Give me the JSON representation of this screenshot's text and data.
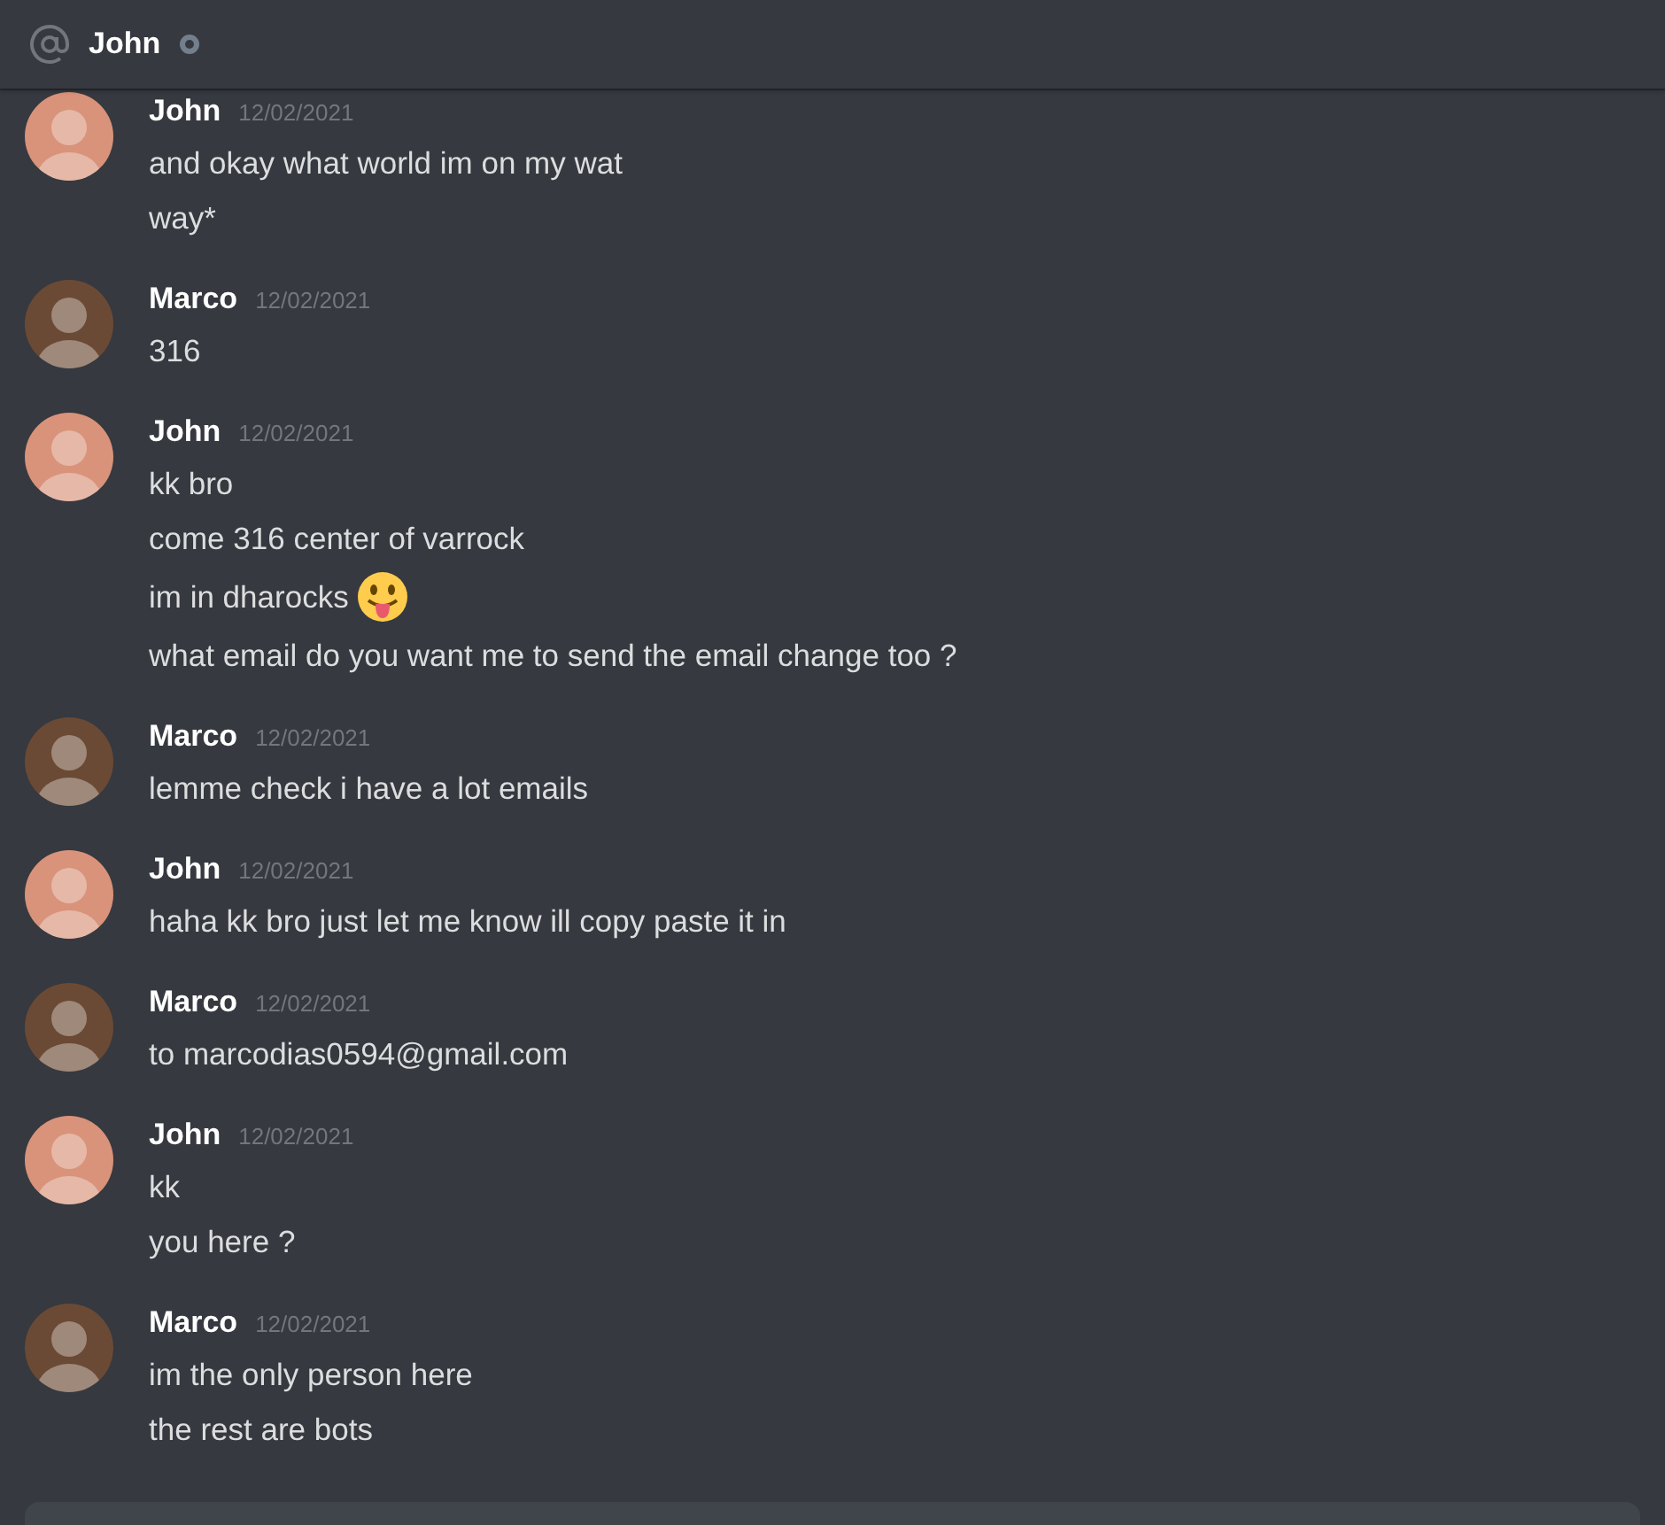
{
  "header": {
    "title": "John",
    "online": false
  },
  "messages": [
    {
      "author": "John",
      "timestamp": "12/02/2021",
      "color": "#d9937a",
      "lines": [
        {
          "text": "and okay what world im on my wat"
        },
        {
          "text": "way*"
        }
      ]
    },
    {
      "author": "Marco",
      "timestamp": "12/02/2021",
      "color": "#6b4a35",
      "lines": [
        {
          "text": "316"
        }
      ]
    },
    {
      "author": "John",
      "timestamp": "12/02/2021",
      "color": "#d9937a",
      "lines": [
        {
          "text": "kk bro"
        },
        {
          "text": "come 316 center of varrock"
        },
        {
          "text": "im in dharocks",
          "has_emoji": true
        },
        {
          "text": "what email do you want me to send the email change too ?"
        }
      ]
    },
    {
      "author": "Marco",
      "timestamp": "12/02/2021",
      "color": "#6b4a35",
      "lines": [
        {
          "text": "lemme check i have a lot emails"
        }
      ]
    },
    {
      "author": "John",
      "timestamp": "12/02/2021",
      "color": "#d9937a",
      "lines": [
        {
          "text": "haha kk bro just let me know ill copy paste it in"
        }
      ]
    },
    {
      "author": "Marco",
      "timestamp": "12/02/2021",
      "color": "#6b4a35",
      "lines": [
        {
          "text": "to marcodias0594@gmail.com"
        }
      ]
    },
    {
      "author": "John",
      "timestamp": "12/02/2021",
      "color": "#d9937a",
      "lines": [
        {
          "text": "kk"
        },
        {
          "text": "you here ?"
        }
      ]
    },
    {
      "author": "Marco",
      "timestamp": "12/02/2021",
      "color": "#6b4a35",
      "lines": [
        {
          "text": "im the only person here"
        },
        {
          "text": "the rest are bots"
        }
      ]
    }
  ]
}
